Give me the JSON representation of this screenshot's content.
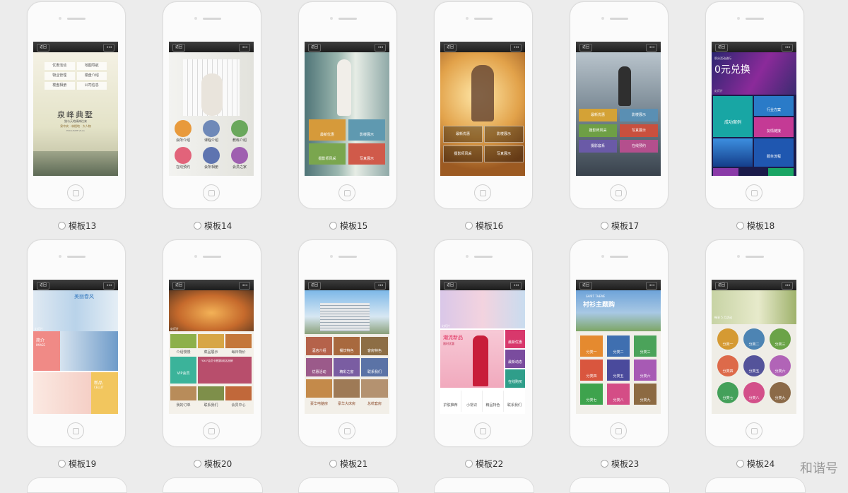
{
  "phone_ui": {
    "back_label": "返回",
    "more_label": "•••"
  },
  "templates": [
    {
      "label": "模板13"
    },
    {
      "label": "模板14"
    },
    {
      "label": "模板15"
    },
    {
      "label": "模板16"
    },
    {
      "label": "模板17"
    },
    {
      "label": "模板18"
    },
    {
      "label": "模板19"
    },
    {
      "label": "模板20"
    },
    {
      "label": "模板21"
    },
    {
      "label": "模板22"
    },
    {
      "label": "模板23"
    },
    {
      "label": "模板24"
    }
  ],
  "t13": {
    "menu": [
      "优惠活动",
      "地图导航",
      "物业管理",
      "楼盘介绍",
      "楼盘相册",
      "公司信息"
    ],
    "title": "泉峰典墅",
    "subtitle": "独与天地精神往来",
    "tagline": "泉中央 · 林栖地 · 大人物",
    "en": "EXCLUSIVE VILLA"
  },
  "t14": {
    "items": [
      "会所介绍",
      "课程介绍",
      "教练介绍",
      "在线预约",
      "会所相册",
      "会员之家"
    ]
  },
  "t15": {
    "items": [
      "最新优惠",
      "影楼展示",
      "摄影师风采",
      "写真展示"
    ]
  },
  "t16": {
    "items": [
      "最新优惠",
      "影楼展示",
      "摄影师风采",
      "写真展示"
    ]
  },
  "t17": {
    "items": [
      "最新优惠",
      "影楼展示",
      "摄影师风采",
      "写真展示",
      "摄影套系",
      "在线预约"
    ]
  },
  "t18": {
    "banner": "0元兑换",
    "banner_small": "积分活动进行",
    "caption": "幻灯片",
    "items": [
      "成功案例",
      "行业方案",
      "友情链接",
      "服务流程"
    ]
  },
  "t19": {
    "banner_text": "美丽春风",
    "caption": "幻灯片",
    "block1": "简介",
    "block1_en": "IMAGE",
    "block2": "新品",
    "block2_en": "CELLIT"
  },
  "t20": {
    "caption": "幻灯片",
    "items": [
      "介绍慢慢",
      "菜品展示",
      "每日特价"
    ],
    "vip": "VIP会员",
    "vip_text": "\"XXX\"会员卡是国际知名品牌",
    "bottom": [
      "我的订单",
      "联系我们",
      "会员中心"
    ]
  },
  "t21": {
    "items": [
      "酒店介绍",
      "餐饮特色",
      "客房特色",
      "优惠活动",
      "精彩之窗",
      "联系我们",
      "豪华电脑房",
      "豪华大床房",
      "总统套房"
    ]
  },
  "t22": {
    "caption": "幻灯片",
    "promo": "潮流新品",
    "promo_sub": "限时优惠",
    "side": [
      "最新优惠",
      "最新动态",
      "在线购买"
    ],
    "bottom": [
      "护肤推荐",
      "小常识",
      "精品特色",
      "联系我们"
    ]
  },
  "t23": {
    "banner": "衬衫主题购",
    "banner_en": "SHIRT THEME",
    "items": [
      "分类一",
      "分类二",
      "分类三",
      "分类四",
      "分类五",
      "分类六",
      "分类七",
      "分类八",
      "分类九"
    ]
  },
  "t24": {
    "caption": "畅享 5 月活动",
    "items": [
      "分类一",
      "分类二",
      "分类三",
      "分类四",
      "分类五",
      "分类六",
      "分类七",
      "分类八",
      "分类九"
    ]
  },
  "watermark": "和谐号",
  "colors": {
    "background": "#ececec",
    "phone": "#fbfbfb",
    "teal": "#1aa9a8",
    "purple": "#6b3fa6",
    "pink": "#d54878",
    "orange": "#e6862d"
  }
}
